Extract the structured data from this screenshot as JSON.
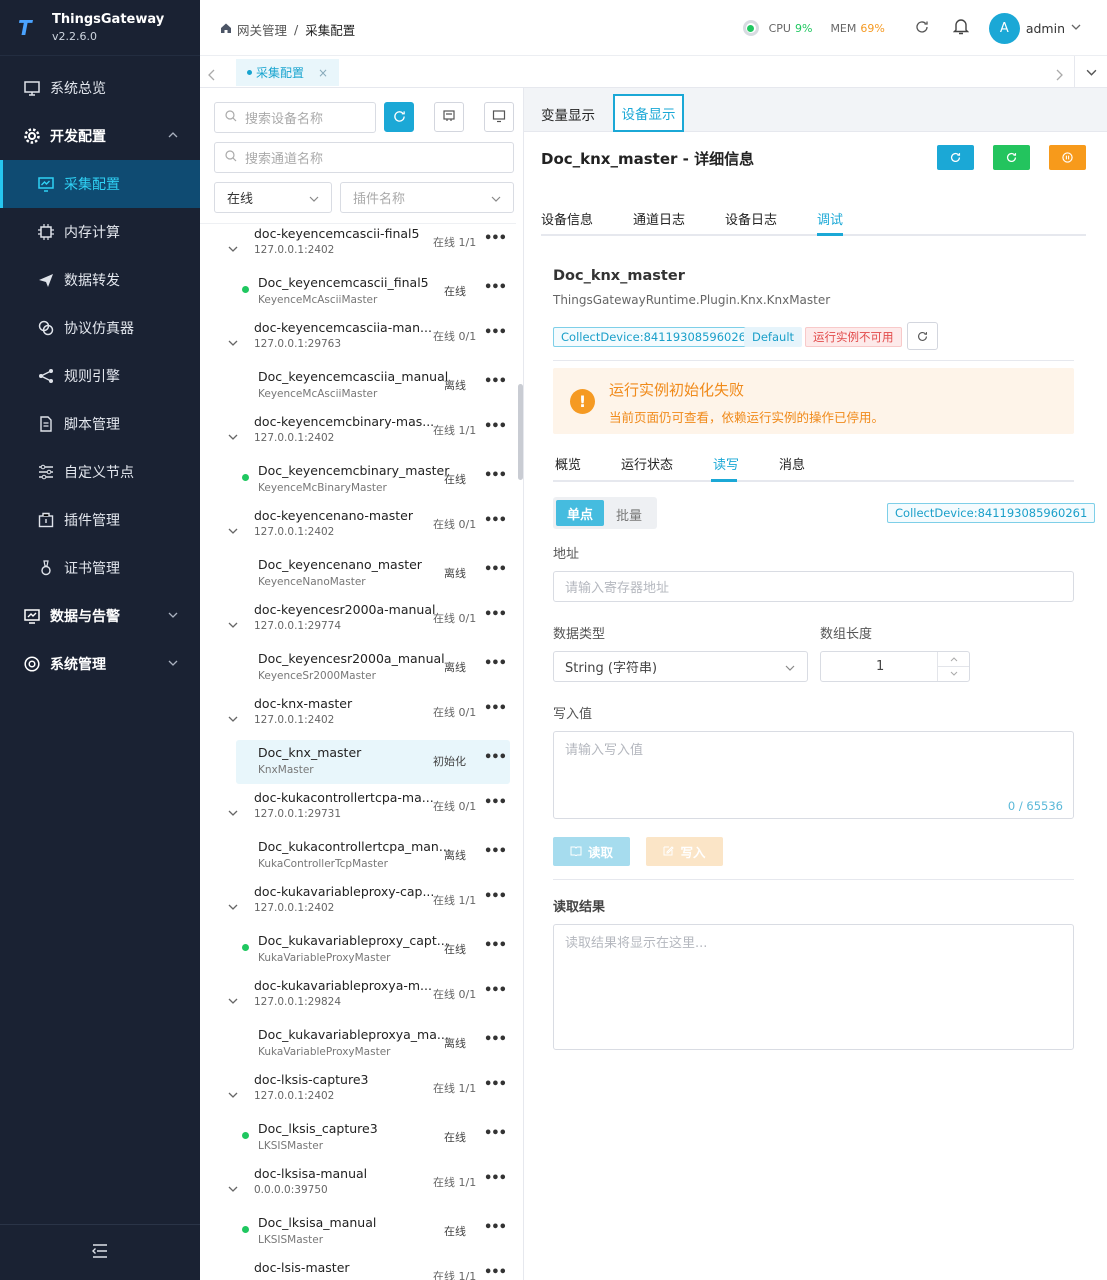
{
  "app": {
    "name": "ThingsGateway",
    "version": "v2.2.6.0"
  },
  "sidebar": {
    "items": [
      {
        "label": "系统总览",
        "icon": "monitor-icon"
      },
      {
        "label": "开发配置",
        "icon": "gear-icon"
      },
      {
        "label": "采集配置",
        "icon": "chart-board-icon"
      },
      {
        "label": "内存计算",
        "icon": "chip-icon"
      },
      {
        "label": "数据转发",
        "icon": "send-icon"
      },
      {
        "label": "协议仿真器",
        "icon": "link-icon"
      },
      {
        "label": "规则引擎",
        "icon": "share-icon"
      },
      {
        "label": "脚本管理",
        "icon": "document-icon"
      },
      {
        "label": "自定义节点",
        "icon": "sliders-icon"
      },
      {
        "label": "插件管理",
        "icon": "package-icon"
      },
      {
        "label": "证书管理",
        "icon": "certificate-icon"
      },
      {
        "label": "数据与告警",
        "icon": "alarm-board-icon"
      },
      {
        "label": "系统管理",
        "icon": "settings-icon"
      }
    ]
  },
  "header": {
    "breadcrumb_parent": "网关管理",
    "breadcrumb_sep": "/",
    "breadcrumb_current": "采集配置",
    "cpu_label": "CPU",
    "cpu_value": "9%",
    "mem_label": "MEM",
    "mem_value": "69%",
    "avatar_letter": "A",
    "user": "admin"
  },
  "tabs": {
    "open_tab": "采集配置"
  },
  "left": {
    "search_device_placeholder": "搜索设备名称",
    "search_channel_placeholder": "搜索通道名称",
    "status_select": "在线",
    "plugin_select_placeholder": "插件名称",
    "tree": [
      {
        "channel": "doc-keyencemcascii-final5",
        "ip": "127.0.0.1:2402",
        "stat": "在线 1/1",
        "device": "Doc_keyencemcascii_final5",
        "plugin": "KeyenceMcAsciiMaster",
        "dstat": "在线",
        "online": true
      },
      {
        "channel": "doc-keyencemcasciia-man...",
        "ip": "127.0.0.1:29763",
        "stat": "在线 0/1",
        "device": "Doc_keyencemcasciia_manual",
        "plugin": "KeyenceMcAsciiMaster",
        "dstat": "离线",
        "online": false
      },
      {
        "channel": "doc-keyencemcbinary-mas...",
        "ip": "127.0.0.1:2402",
        "stat": "在线 1/1",
        "device": "Doc_keyencemcbinary_master",
        "plugin": "KeyenceMcBinaryMaster",
        "dstat": "在线",
        "online": true
      },
      {
        "channel": "doc-keyencenano-master",
        "ip": "127.0.0.1:2402",
        "stat": "在线 0/1",
        "device": "Doc_keyencenano_master",
        "plugin": "KeyenceNanoMaster",
        "dstat": "离线",
        "online": false
      },
      {
        "channel": "doc-keyencesr2000a-manual",
        "ip": "127.0.0.1:29774",
        "stat": "在线 0/1",
        "device": "Doc_keyencesr2000a_manual",
        "plugin": "KeyenceSr2000Master",
        "dstat": "离线",
        "online": false
      },
      {
        "channel": "doc-knx-master",
        "ip": "127.0.0.1:2402",
        "stat": "在线 0/1",
        "device": "Doc_knx_master",
        "plugin": "KnxMaster",
        "dstat": "初始化",
        "online": false,
        "selected": true
      },
      {
        "channel": "doc-kukacontrollertcpa-ma...",
        "ip": "127.0.0.1:29731",
        "stat": "在线 0/1",
        "device": "Doc_kukacontrollertcpa_man...",
        "plugin": "KukaControllerTcpMaster",
        "dstat": "离线",
        "online": false
      },
      {
        "channel": "doc-kukavariableproxy-cap...",
        "ip": "127.0.0.1:2402",
        "stat": "在线 1/1",
        "device": "Doc_kukavariableproxy_capt...",
        "plugin": "KukaVariableProxyMaster",
        "dstat": "在线",
        "online": true
      },
      {
        "channel": "doc-kukavariableproxya-m...",
        "ip": "127.0.0.1:29824",
        "stat": "在线 0/1",
        "device": "Doc_kukavariableproxya_ma...",
        "plugin": "KukaVariableProxyMaster",
        "dstat": "离线",
        "online": false
      },
      {
        "channel": "doc-lksis-capture3",
        "ip": "127.0.0.1:2402",
        "stat": "在线 1/1",
        "device": "Doc_lksis_capture3",
        "plugin": "LKSISMaster",
        "dstat": "在线",
        "online": true
      },
      {
        "channel": "doc-lksisa-manual",
        "ip": "0.0.0.0:39750",
        "stat": "在线 1/1",
        "device": "Doc_lksisa_manual",
        "plugin": "LKSISMaster",
        "dstat": "在线",
        "online": true
      },
      {
        "channel": "doc-lsis-master",
        "ip": "",
        "stat": "在线 1/1",
        "device": "",
        "plugin": "",
        "dstat": "",
        "online": true
      }
    ]
  },
  "right": {
    "view_tabs": [
      "变量显示",
      "设备显示"
    ],
    "title": "Doc_knx_master - 详细信息",
    "detail_tabs": [
      "设备信息",
      "通道日志",
      "设备日志",
      "调试"
    ],
    "device_name": "Doc_knx_master",
    "device_plugin": "ThingsGatewayRuntime.Plugin.Knx.KnxMaster",
    "tag_collect": "CollectDevice:841193085960261",
    "tag_default": "Default",
    "tag_error": "运行实例不可用",
    "alert_title": "运行实例初始化失败",
    "alert_desc": "当前页面仍可查看，依赖运行实例的操作已停用。",
    "inner_tabs": [
      "概览",
      "运行状态",
      "读写",
      "消息"
    ],
    "mode_single": "单点",
    "mode_batch": "批量",
    "collect_tag": "CollectDevice:841193085960261",
    "address_label": "地址",
    "address_placeholder": "请输入寄存器地址",
    "datatype_label": "数据类型",
    "datatype_value": "String (字符串)",
    "arraylen_label": "数组长度",
    "arraylen_value": "1",
    "write_label": "写入值",
    "write_placeholder": "请输入写入值",
    "write_counter": "0 / 65536",
    "read_btn": "读取",
    "write_btn": "写入",
    "result_label": "读取结果",
    "result_placeholder": "读取结果将显示在这里..."
  },
  "colors": {
    "accent": "#1ba8d6",
    "sidebar_bg": "#1a2233",
    "online": "#1fc760",
    "warning": "#f59a23"
  }
}
